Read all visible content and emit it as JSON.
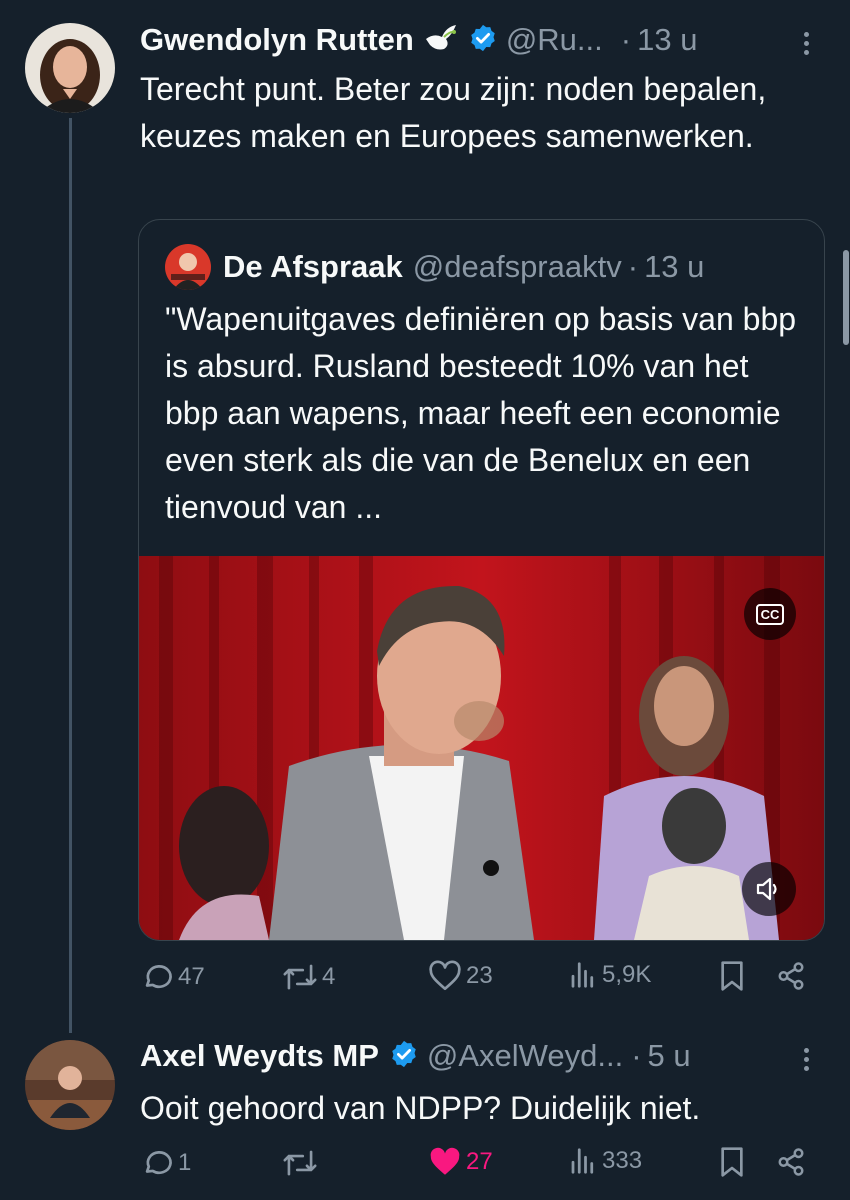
{
  "tweet": {
    "author_name": "Gwendolyn Rutten",
    "author_handle": "@Ru...",
    "time": "13 u",
    "text": "Terecht punt. Beter zou zijn: noden bepalen, keuzes maken en Europees samenwerken.",
    "quote": {
      "author_name": "De Afspraak",
      "author_handle": "@deafspraaktv",
      "time": "13 u",
      "text": "\"Wapenuitgaves definiëren op basis van bbp is absurd. Rusland besteedt 10% van het bbp aan wapens, maar heeft een economie even sterk als die van de Benelux en een tienvoud van ...",
      "cc_label": "CC"
    },
    "stats": {
      "replies": "47",
      "reposts": "4",
      "likes": "23",
      "views": "5,9K"
    }
  },
  "reply": {
    "author_name": "Axel Weydts MP",
    "author_handle": "@AxelWeyd...",
    "time": "5 u",
    "text": "Ooit gehoord van NDPP? Duidelijk niet.",
    "stats": {
      "replies": "1",
      "reposts": "",
      "likes": "27",
      "views": "333"
    },
    "liked": true
  },
  "colors": {
    "background": "#15202b",
    "muted": "#8b98a5",
    "verified": "#1d9bf0",
    "like_active": "#f91880"
  },
  "icons": [
    "dove-emoji",
    "verified-badge-icon",
    "more-icon",
    "cc-icon",
    "volume-icon",
    "reply-icon",
    "repost-icon",
    "like-icon",
    "views-icon",
    "bookmark-icon",
    "share-icon"
  ]
}
